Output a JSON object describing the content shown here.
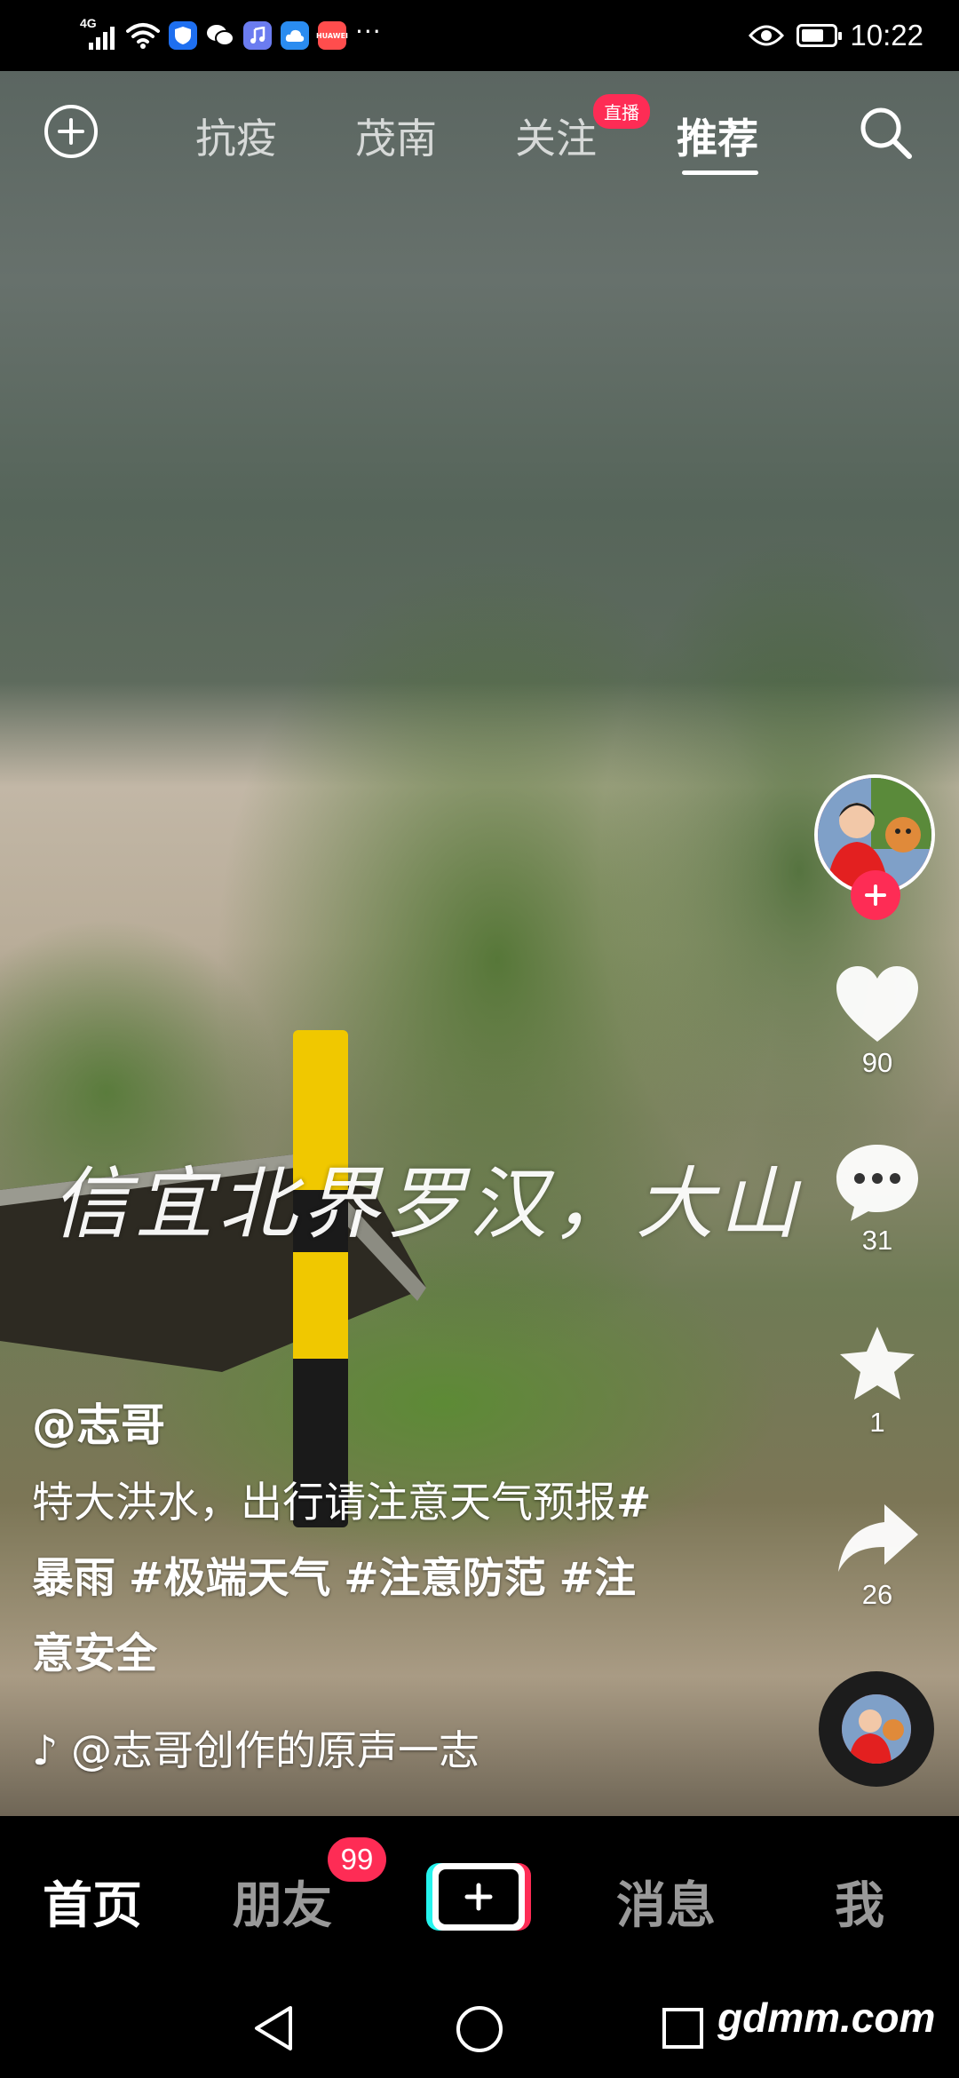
{
  "status_bar": {
    "network": "4G",
    "time": "10:22",
    "more": "···",
    "app_icons": [
      "shield-icon",
      "wechat-icon",
      "music-app-icon",
      "cloud-app-icon",
      "huawei-app-icon"
    ],
    "huawei_label": "HUAWEI",
    "battery_level": 0.7
  },
  "top_nav": {
    "tabs": [
      {
        "label": "抗疫",
        "active": false
      },
      {
        "label": "茂南",
        "active": false
      },
      {
        "label": "关注",
        "active": false
      },
      {
        "label": "推荐",
        "active": true
      }
    ],
    "live_badge": "直播"
  },
  "video": {
    "overlay_text": "信宜北界罗汉，大山"
  },
  "sidebar": {
    "likes": "90",
    "comments": "31",
    "favorites": "1",
    "shares": "26"
  },
  "caption": {
    "author": "@志哥",
    "text": "特大洪水，出行请注意天气预报",
    "tags": [
      "#暴雨",
      "#极端天气",
      "#注意防范",
      "#注意安全"
    ],
    "music": "@志哥创作的原声一志"
  },
  "bottom_nav": {
    "items": [
      {
        "label": "首页",
        "active": true
      },
      {
        "label": "朋友",
        "active": false
      },
      {
        "label": "消息",
        "active": false
      },
      {
        "label": "我",
        "active": false
      }
    ],
    "friends_badge": "99"
  },
  "watermark": "gdmm.com",
  "colors": {
    "accent": "#fe2c55",
    "cyan": "#25f4ee",
    "post_yellow": "#f0c800"
  }
}
